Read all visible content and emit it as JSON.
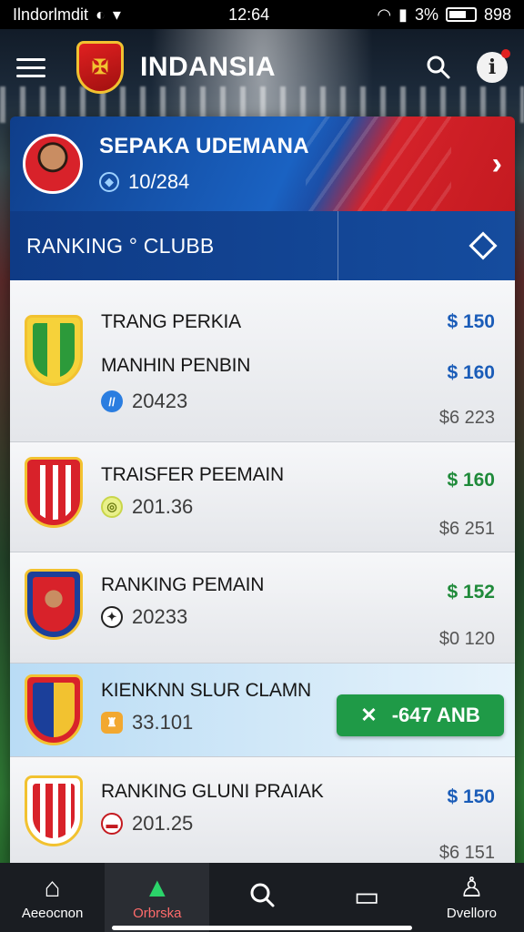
{
  "status_bar": {
    "carrier": "Ilndorlmdit",
    "time": "12:64",
    "battery_pct": "3%",
    "extra": "898"
  },
  "app_bar": {
    "title": "INDANSIA",
    "logo_text": "✠"
  },
  "profile": {
    "name": "SEPAKA UDEMANA",
    "id": "10/284"
  },
  "section": {
    "title": "RANKING ° CLUBB"
  },
  "rows": [
    {
      "title": "TRANG PERKIA",
      "subtitle": "MANHIN PENBIN",
      "meta": "20423",
      "price1": "$ 150",
      "price2": "$ 160",
      "total": "$6 223",
      "badge_color": "#2c9a3a",
      "meta_icon": "#2a7de0"
    },
    {
      "title": "TRAISFER PEEMAIN",
      "meta": "201.36",
      "price1": "$ 160",
      "total": "$6 251",
      "badge_color": "#d8222a",
      "meta_icon": "#c9d64a"
    },
    {
      "title": "RANKING PEMAIN",
      "meta": "20233",
      "price1": "$ 152",
      "total": "$0 120",
      "badge_color": "#1b3f9a",
      "meta_icon": "#222222"
    },
    {
      "title": "KIENKNN SLUR CLAMN",
      "meta": "33.101",
      "button": "-647  ANB",
      "badge_color": "#d8222a",
      "meta_icon": "#f2a830"
    },
    {
      "title": "RANKING GLUNI PRAIAK",
      "meta": "201.25",
      "price1": "$ 150",
      "total": "$6 151",
      "badge_color": "#d8222a",
      "meta_icon": "#c41a20"
    }
  ],
  "nav": [
    {
      "label": "Aeeocnon",
      "icon": "home-icon"
    },
    {
      "label": "Orbrska",
      "icon": "chart-icon"
    },
    {
      "label": "",
      "icon": "search-icon"
    },
    {
      "label": "",
      "icon": "wallet-icon"
    },
    {
      "label": "Dvelloro",
      "icon": "profile-icon"
    }
  ],
  "colors": {
    "primary": "#154c9e",
    "accent": "#d4222a",
    "success": "#1f9a47"
  }
}
